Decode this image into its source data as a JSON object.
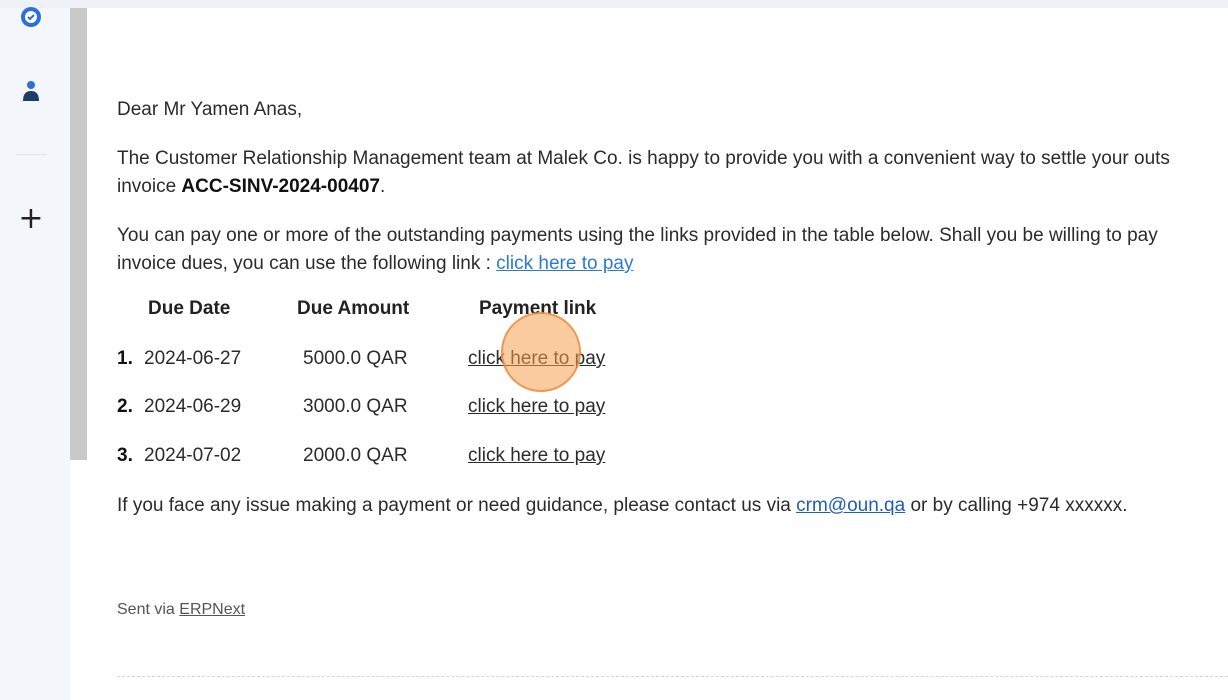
{
  "email": {
    "greeting": "Dear Mr Yamen Anas,",
    "para1_line1": "The Customer Relationship Management team at Malek Co. is happy to provide you with a convenient way to settle your outs",
    "para1_line2_prefix": "invoice ",
    "invoice_id": "ACC-SINV-2024-00407",
    "para1_line2_suffix": ".",
    "para2_line1": "You can pay one or more of the outstanding payments using the links provided in the table below. Shall you be willing to pay",
    "para2_line2_prefix": "invoice dues, you can use the following link : ",
    "pay_all_link": "click here to pay",
    "table": {
      "headers": [
        "Due Date",
        "Due Amount",
        "Payment link"
      ],
      "rows": [
        {
          "num": "1.",
          "date": "2024-06-27",
          "amount": "5000.0 QAR",
          "link": "click here to pay"
        },
        {
          "num": "2.",
          "date": "2024-06-29",
          "amount": "3000.0 QAR",
          "link": "click here to pay"
        },
        {
          "num": "3.",
          "date": "2024-07-02",
          "amount": "2000.0 QAR",
          "link": "click here to pay"
        }
      ]
    },
    "contact_prefix": "If you face any issue making a payment or need guidance, please contact us via ",
    "contact_email": "crm@oun.qa",
    "contact_suffix": " or by calling +974 xxxxxx.",
    "sent_via_prefix": "Sent via ",
    "sent_via_link": "ERPNext"
  },
  "sidebar": {
    "icons": [
      "check-badge-icon",
      "user-icon",
      "plus-icon"
    ],
    "accent_color": "#2d6fd8"
  }
}
